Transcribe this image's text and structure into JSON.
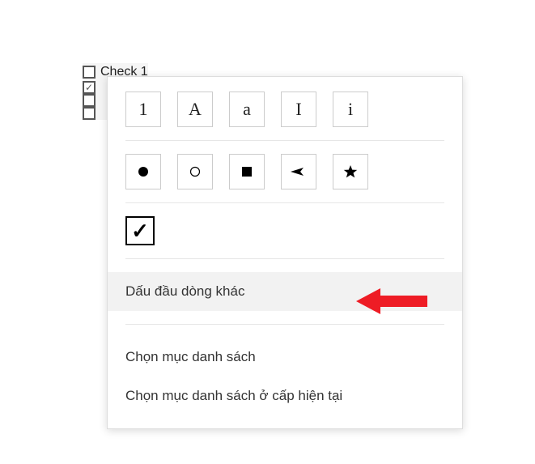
{
  "checklist": {
    "items": [
      {
        "label": "Check 1",
        "checked": false
      },
      {
        "label": "",
        "checked": true
      },
      {
        "label": "",
        "checked": false
      },
      {
        "label": "",
        "checked": false
      }
    ]
  },
  "popup": {
    "number_bullets": [
      "1",
      "A",
      "a",
      "I",
      "i"
    ],
    "shape_bullets": [
      "disc",
      "circle",
      "square",
      "arrow",
      "star"
    ],
    "menu": {
      "other_bullet": "Dấu đầu dòng khác",
      "select_list_item": "Chọn mục danh sách",
      "select_list_item_current_level": "Chọn mục danh sách ở cấp hiện tại"
    }
  }
}
